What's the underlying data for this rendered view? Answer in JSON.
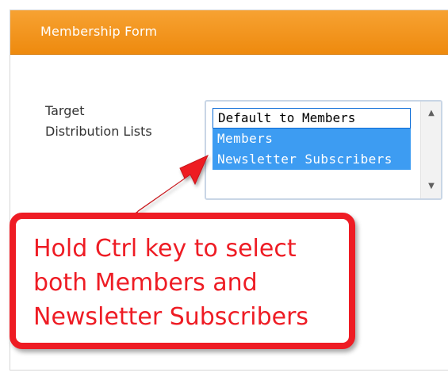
{
  "form": {
    "title": "Membership Form"
  },
  "field": {
    "label_line1": "Target",
    "label_line2": "Distribution Lists"
  },
  "listbox": {
    "options": [
      {
        "label": "Default to Members",
        "selected": false,
        "focused": true
      },
      {
        "label": "Members",
        "selected": true,
        "focused": false
      },
      {
        "label": "Newsletter Subscribers",
        "selected": true,
        "focused": false
      }
    ]
  },
  "callout": {
    "line1": "Hold Ctrl key to select",
    "line2": "both Members and",
    "line3": "Newsletter Subscribers"
  },
  "colors": {
    "header_orange": "#f29418",
    "selection_blue": "#3d9cf2",
    "callout_red": "#ee1c24"
  },
  "icons": {
    "scroll_up": "triangle-up-icon",
    "scroll_down": "triangle-down-icon",
    "annotation_arrow": "arrow-icon"
  }
}
